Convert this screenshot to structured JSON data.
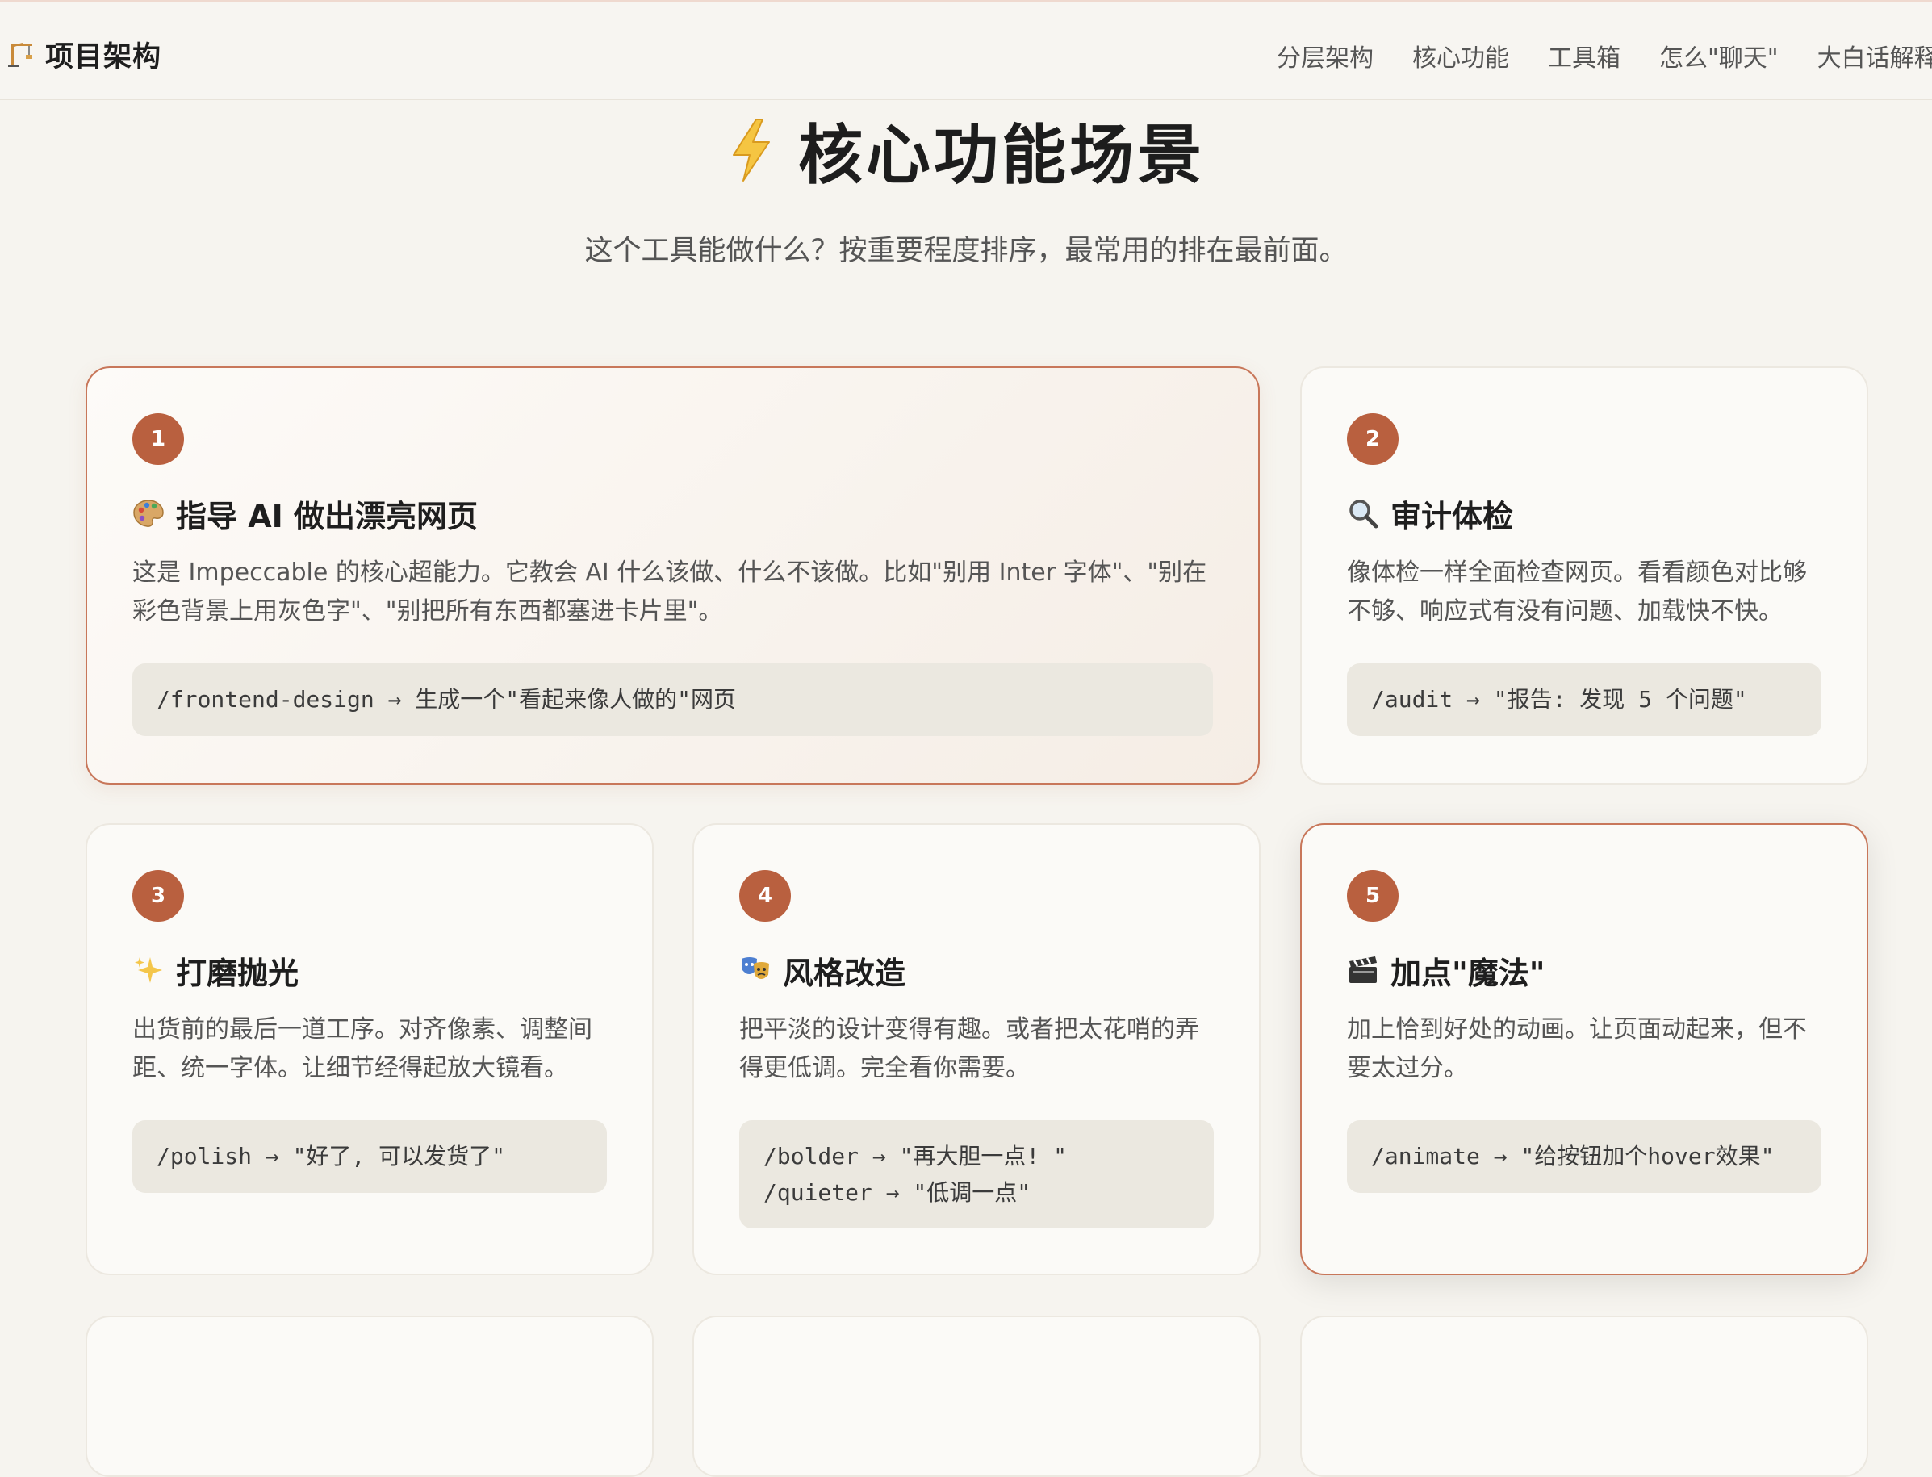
{
  "header": {
    "brand_icon": "construction-crane-icon",
    "brand": "项目架构",
    "nav": [
      {
        "label": "分层架构"
      },
      {
        "label": "核心功能"
      },
      {
        "label": "工具箱"
      },
      {
        "label": "怎么\"聊天\""
      },
      {
        "label": "大白话解释"
      }
    ]
  },
  "hero": {
    "icon": "lightning-bolt-icon",
    "title": "核心功能场景",
    "subtitle": "这个工具能做什么？按重要程度排序，最常用的排在最前面。"
  },
  "cards": [
    {
      "number": "1",
      "icon": "palette-icon",
      "title": "指导 AI 做出漂亮网页",
      "desc": "这是 Impeccable 的核心超能力。它教会 AI 什么该做、什么不该做。比如\"别用 Inter 字体\"、\"别在彩色背景上用灰色字\"、\"别把所有东西都塞进卡片里\"。",
      "commands": [
        "/frontend-design → 生成一个\"看起来像人做的\"网页"
      ]
    },
    {
      "number": "2",
      "icon": "magnifier-icon",
      "title": "审计体检",
      "desc": "像体检一样全面检查网页。看看颜色对比够不够、响应式有没有问题、加载快不快。",
      "commands": [
        "/audit → \"报告: 发现 5 个问题\""
      ]
    },
    {
      "number": "3",
      "icon": "sparkles-icon",
      "title": "打磨抛光",
      "desc": "出货前的最后一道工序。对齐像素、调整间距、统一字体。让细节经得起放大镜看。",
      "commands": [
        "/polish → \"好了, 可以发货了\""
      ]
    },
    {
      "number": "4",
      "icon": "theater-masks-icon",
      "title": "风格改造",
      "desc": "把平淡的设计变得有趣。或者把太花哨的弄得更低调。完全看你需要。",
      "commands": [
        "/bolder → \"再大胆一点! \"",
        "/quieter → \"低调一点\""
      ]
    },
    {
      "number": "5",
      "icon": "clapperboard-icon",
      "title": "加点\"魔法\"",
      "desc": "加上恰到好处的动画。让页面动起来，但不要太过分。",
      "commands": [
        "/animate → \"给按钮加个hover效果\""
      ]
    }
  ]
}
